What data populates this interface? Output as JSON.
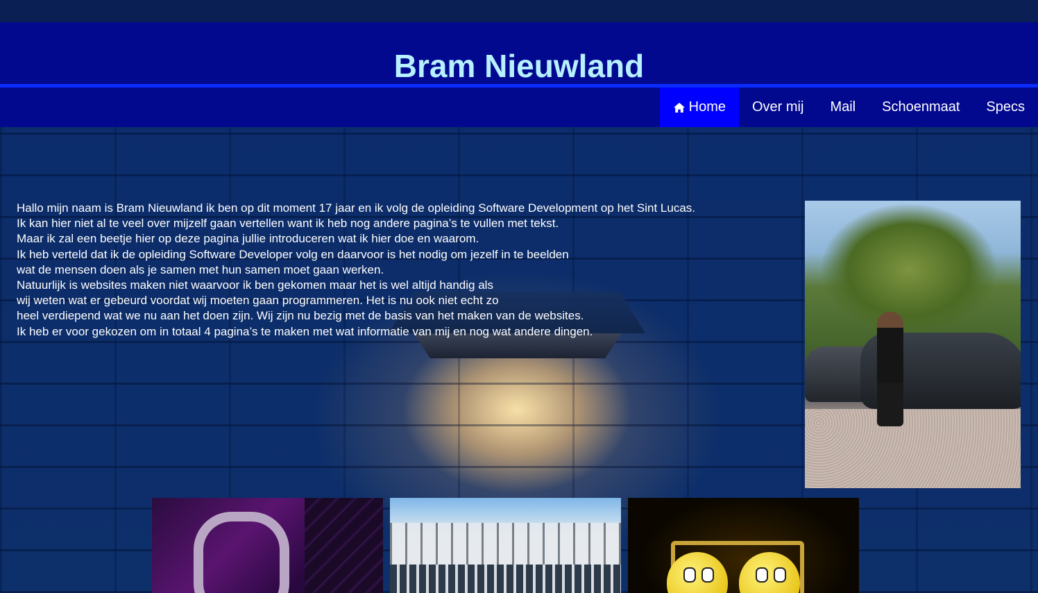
{
  "header": {
    "title": "Bram Nieuwland"
  },
  "nav": {
    "items": [
      {
        "label": "Home",
        "icon": "home-icon",
        "active": true
      },
      {
        "label": "Over mij",
        "active": false
      },
      {
        "label": "Mail",
        "active": false
      },
      {
        "label": "Schoenmaat",
        "active": false
      },
      {
        "label": "Specs",
        "active": false
      }
    ]
  },
  "intro": {
    "lines": [
      "Hallo mijn naam is Bram Nieuwland ik ben op dit moment 17 jaar en ik volg de opleiding Software Development op het Sint Lucas.",
      "Ik kan hier niet al te veel over mijzelf gaan vertellen want ik heb nog andere pagina’s te vullen met tekst.",
      "Maar ik zal een beetje hier op deze pagina jullie introduceren wat ik hier doe en waarom.",
      "Ik heb verteld dat ik de opleiding Software Developer volg en daarvoor is het nodig om jezelf in te beelden",
      "wat de mensen doen als je samen met hun samen moet gaan werken.",
      "Natuurlijk is websites maken niet waarvoor ik ben gekomen maar het is wel altijd handig als",
      "wij weten wat er gebeurd voordat wij moeten gaan programmeren. Het is nu ook niet echt zo",
      "heel verdiepend wat we nu aan het doen zijn. Wij zijn nu bezig met de basis van het maken van de websites.",
      "Ik heb er voor gekozen om in totaal 4 pagina’s te maken met wat informatie van mij en nog wat andere dingen."
    ]
  },
  "colors": {
    "header_bg": "#03098f",
    "nav_active": "#0000ff",
    "title": "#b7f0ff",
    "divider": "#0a2cff"
  }
}
